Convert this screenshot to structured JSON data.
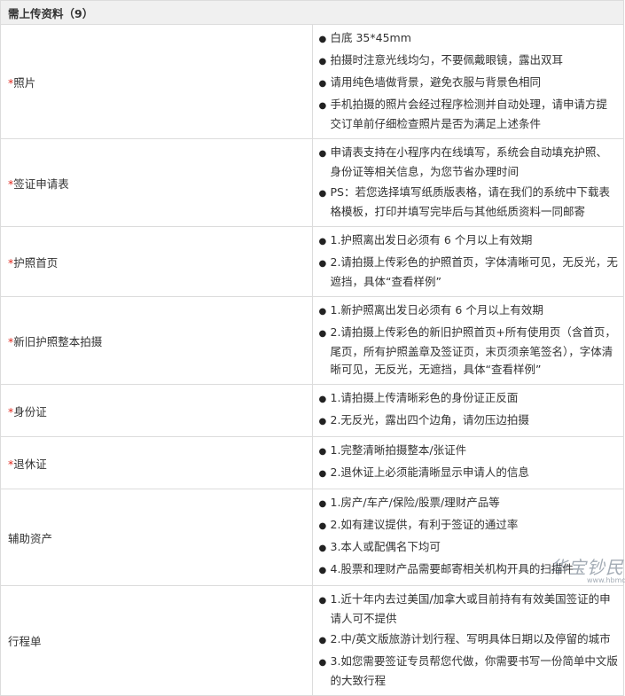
{
  "header": {
    "title": "需上传资料（9）"
  },
  "rows": [
    {
      "required_mark": "*",
      "label": "照片",
      "items": [
        "白底 35*45mm",
        "拍摄时注意光线均匀，不要佩戴眼镜，露出双耳",
        "请用纯色墙做背景，避免衣服与背景色相同",
        "手机拍摄的照片会经过程序检测并自动处理，请申请方提交订单前仔细检查照片是否为满足上述条件"
      ]
    },
    {
      "required_mark": "*",
      "label": "签证申请表",
      "items": [
        "申请表支持在小程序内在线填写，系统会自动填充护照、身份证等相关信息，为您节省办理时间",
        "PS：若您选择填写纸质版表格，请在我们的系统中下载表格模板，打印并填写完毕后与其他纸质资料一同邮寄"
      ]
    },
    {
      "required_mark": "*",
      "label": "护照首页",
      "items": [
        "1.护照离出发日必须有 6 个月以上有效期",
        "2.请拍摄上传彩色的护照首页，字体清晰可见，无反光，无遮挡，具体“查看样例”"
      ]
    },
    {
      "required_mark": "*",
      "label": "新旧护照整本拍摄",
      "items": [
        "1.新护照离出发日必须有 6 个月以上有效期",
        "2.请拍摄上传彩色的新旧护照首页+所有使用页（含首页，尾页，所有护照盖章及签证页，末页须亲笔签名），字体清晰可见，无反光，无遮挡，具体“查看样例”"
      ]
    },
    {
      "required_mark": "*",
      "label": "身份证",
      "items": [
        "1.请拍摄上传清晰彩色的身份证正反面",
        "2.无反光，露出四个边角，请勿压边拍摄"
      ]
    },
    {
      "required_mark": "*",
      "label": "退休证",
      "items": [
        "1.完整清晰拍摄整本/张证件",
        "2.退休证上必须能清晰显示申请人的信息"
      ]
    },
    {
      "required_mark": "",
      "label": "辅助资产",
      "items": [
        "1.房产/车产/保险/股票/理财产品等",
        "2.如有建议提供，有利于签证的通过率",
        "3.本人或配偶名下均可",
        "4.股票和理财产品需要邮寄相关机构开具的扫描件"
      ]
    },
    {
      "required_mark": "",
      "label": "行程单",
      "items": [
        "1.近十年内去过美国/加拿大或目前持有有效美国签证的申请人可不提供",
        "2.中/英文版旅游计划行程、写明具体日期以及停留的城市",
        "3.如您需要签证专员帮您代做，你需要书写一份简单中文版的大致行程"
      ]
    }
  ],
  "bullet_glyph": "●",
  "watermark": {
    "title": "华宝钞民",
    "subtitle": "www.hbmd.com"
  },
  "colors": {
    "required": "#e0261c",
    "header_bg": "#f0f0f0",
    "border": "#dcdcdc"
  }
}
